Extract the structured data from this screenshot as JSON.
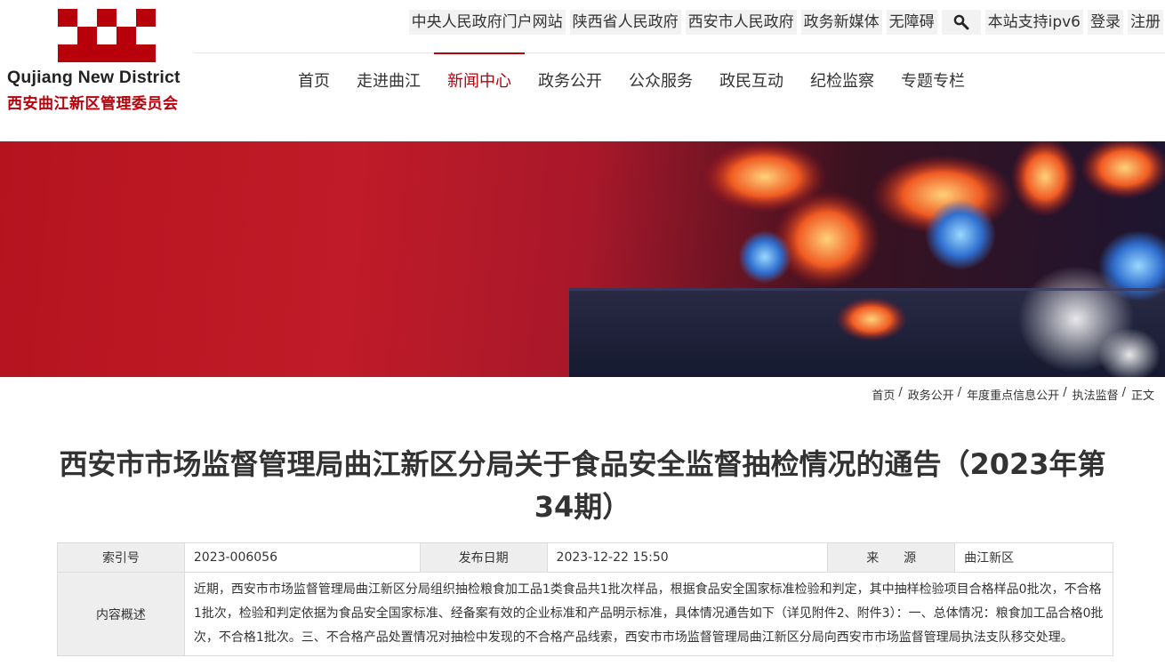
{
  "logo": {
    "english": "Qujiang New District",
    "chinese": "西安曲江新区管理委员会"
  },
  "top_links": [
    {
      "label": "中央人民政府门户网站"
    },
    {
      "label": "陕西省人民政府"
    },
    {
      "label": "西安市人民政府"
    },
    {
      "label": "政务新媒体"
    },
    {
      "label": "无障碍"
    }
  ],
  "search_icon": "search-icon",
  "top_links_right": [
    {
      "label": "本站支持ipv6"
    },
    {
      "label": "登录"
    },
    {
      "label": "注册"
    }
  ],
  "nav": [
    {
      "label": "首页",
      "active": false
    },
    {
      "label": "走进曲江",
      "active": false
    },
    {
      "label": "新闻中心",
      "active": true
    },
    {
      "label": "政务公开",
      "active": false
    },
    {
      "label": "公众服务",
      "active": false
    },
    {
      "label": "政民互动",
      "active": false
    },
    {
      "label": "纪检监察",
      "active": false
    },
    {
      "label": "专题专栏",
      "active": false
    }
  ],
  "breadcrumb": [
    "首页",
    "政务公开",
    "年度重点信息公开",
    "执法监督",
    "正文"
  ],
  "breadcrumb_separator": "/",
  "article": {
    "title": "西安市市场监督管理局曲江新区分局关于食品安全监督抽检情况的通告（2023年第34期）"
  },
  "info": {
    "index_label": "索引号",
    "index_value": "2023-006056",
    "date_label": "发布日期",
    "date_value": "2023-12-22 15:50",
    "source_label": "来　　源",
    "source_value": "曲江新区",
    "summary_label": "内容概述",
    "summary_value": "近期，西安市市场监督管理局曲江新区分局组织抽检粮食加工品1类食品共1批次样品，根据食品安全国家标准检验和判定，其中抽样检验项目合格样品0批次，不合格1批次，检验和判定依据为食品安全国家标准、经备案有效的企业标准和产品明示标准，具体情况通告如下（详见附件2、附件3）：一、总体情况：粮食加工品合格0批次，不合格1批次。三、不合格产品处置情况对抽检中发现的不合格产品线索，西安市市场监督管理局曲江新区分局向西安市市场监督管理局执法支队移交处理。"
  },
  "colors": {
    "brand_red": "#b8000a",
    "banner_red": "#c01b28"
  }
}
